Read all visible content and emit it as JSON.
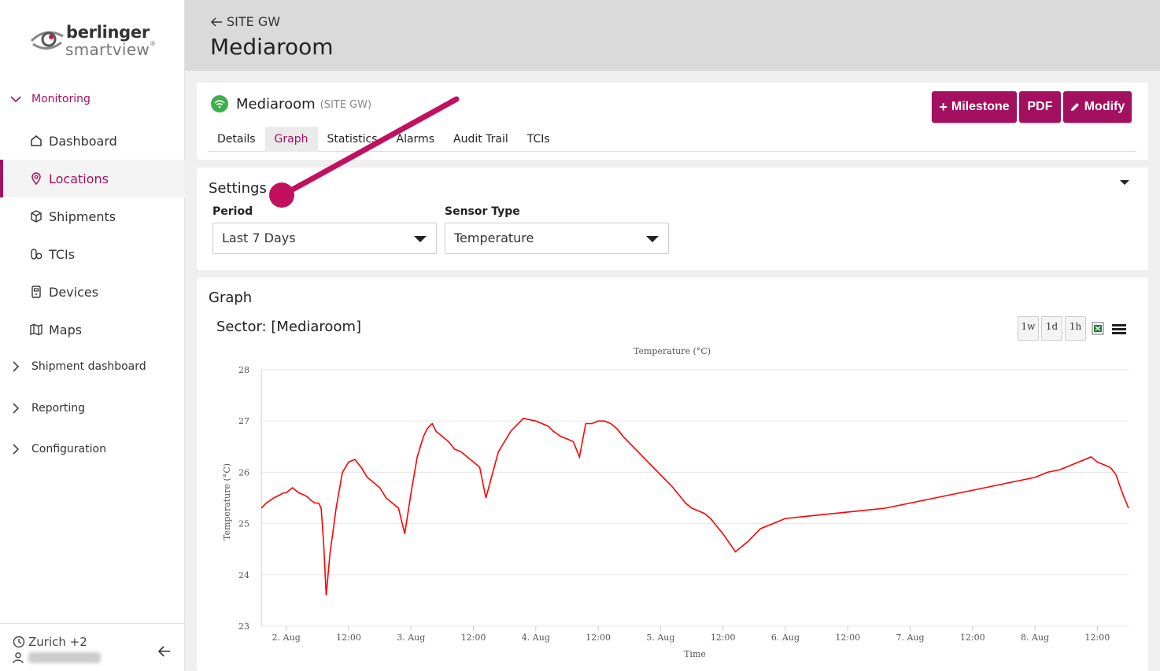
{
  "brand": {
    "line1": "berlinger",
    "line2": "smartview",
    "reg": "®"
  },
  "sidebar": {
    "groups": [
      {
        "label": "Monitoring",
        "open": true
      },
      {
        "label": "Shipment dashboard"
      },
      {
        "label": "Reporting"
      },
      {
        "label": "Configuration"
      }
    ],
    "items": [
      {
        "label": "Dashboard",
        "icon": "home-icon"
      },
      {
        "label": "Locations",
        "icon": "location-pin-icon",
        "active": true
      },
      {
        "label": "Shipments",
        "icon": "box-icon"
      },
      {
        "label": "TCIs",
        "icon": "pills-icon"
      },
      {
        "label": "Devices",
        "icon": "device-icon"
      },
      {
        "label": "Maps",
        "icon": "map-icon"
      }
    ],
    "footer": {
      "zone": "Zurich +2"
    }
  },
  "header": {
    "back_label": "SITE GW",
    "title": "Mediaroom"
  },
  "location": {
    "name": "Mediaroom",
    "site": "(SITE GW)",
    "status_color": "#3cae4a",
    "buttons": {
      "milestone": "Milestone",
      "pdf": "PDF",
      "modify": "Modify"
    },
    "tabs": [
      "Details",
      "Graph",
      "Statistics",
      "Alarms",
      "Audit Trail",
      "TCIs"
    ],
    "active_tab": "Graph"
  },
  "settings": {
    "title": "Settings",
    "period_label": "Period",
    "period_value": "Last 7 Days",
    "sensor_label": "Sensor Type",
    "sensor_value": "Temperature"
  },
  "graph": {
    "title": "Graph",
    "sector": "Sector: [Mediaroom]",
    "zoom_buttons": [
      "1w",
      "1d",
      "1h"
    ]
  },
  "colors": {
    "accent": "#a3105f",
    "line": "#ff0000"
  },
  "chart_data": {
    "type": "line",
    "title": "Temperature (°C)",
    "xlabel": "Time",
    "ylabel": "Temperature (°C)",
    "ylim": [
      23,
      28
    ],
    "yticks": [
      23,
      24,
      25,
      26,
      27,
      28
    ],
    "xlim": [
      0.8,
      7.75
    ],
    "xticks": [
      {
        "x": 1,
        "label": "2. Aug"
      },
      {
        "x": 1.5,
        "label": "12:00"
      },
      {
        "x": 2,
        "label": "3. Aug"
      },
      {
        "x": 2.5,
        "label": "12:00"
      },
      {
        "x": 3,
        "label": "4. Aug"
      },
      {
        "x": 3.5,
        "label": "12:00"
      },
      {
        "x": 4,
        "label": "5. Aug"
      },
      {
        "x": 4.5,
        "label": "12:00"
      },
      {
        "x": 5,
        "label": "6. Aug"
      },
      {
        "x": 5.5,
        "label": "12:00"
      },
      {
        "x": 6,
        "label": "7. Aug"
      },
      {
        "x": 6.5,
        "label": "12:00"
      },
      {
        "x": 7,
        "label": "8. Aug"
      },
      {
        "x": 7.5,
        "label": "12:00"
      }
    ],
    "grid": true,
    "series": [
      {
        "color": "#ff0000",
        "x": [
          0.8,
          0.84,
          0.9,
          0.98,
          1.0,
          1.05,
          1.1,
          1.15,
          1.18,
          1.2,
          1.23,
          1.26,
          1.28,
          1.3,
          1.32,
          1.35,
          1.4,
          1.45,
          1.5,
          1.55,
          1.6,
          1.65,
          1.7,
          1.75,
          1.8,
          1.85,
          1.9,
          1.95,
          2.0,
          2.05,
          2.1,
          2.13,
          2.15,
          2.17,
          2.2,
          2.25,
          2.3,
          2.35,
          2.4,
          2.45,
          2.5,
          2.55,
          2.6,
          2.7,
          2.8,
          2.9,
          3.0,
          3.05,
          3.1,
          3.12,
          3.14,
          3.17,
          3.2,
          3.25,
          3.3,
          3.35,
          3.4,
          3.45,
          3.5,
          3.55,
          3.6,
          3.65,
          3.7,
          3.8,
          3.9,
          4.0,
          4.1,
          4.15,
          4.2,
          4.25,
          4.3,
          4.35,
          4.4,
          4.45,
          4.5,
          4.6,
          4.7,
          4.8,
          4.9,
          5.0,
          5.2,
          5.4,
          5.6,
          5.8,
          6.0,
          6.2,
          6.4,
          6.6,
          6.8,
          7.0,
          7.1,
          7.2,
          7.25,
          7.3,
          7.35,
          7.4,
          7.45,
          7.5,
          7.55,
          7.6,
          7.62,
          7.65,
          7.7,
          7.75
        ],
        "values": [
          25.3,
          25.4,
          25.5,
          25.6,
          25.6,
          25.7,
          25.6,
          25.55,
          25.5,
          25.45,
          25.4,
          25.4,
          25.3,
          24.6,
          23.6,
          24.4,
          25.3,
          26.0,
          26.2,
          26.25,
          26.1,
          25.9,
          25.8,
          25.7,
          25.5,
          25.4,
          25.3,
          24.8,
          25.6,
          26.3,
          26.7,
          26.85,
          26.9,
          26.95,
          26.8,
          26.7,
          26.6,
          26.45,
          26.4,
          26.3,
          26.2,
          26.1,
          25.5,
          26.4,
          26.8,
          27.05,
          27.0,
          26.95,
          26.9,
          26.85,
          26.8,
          26.75,
          26.7,
          26.65,
          26.6,
          26.3,
          26.95,
          26.95,
          27.0,
          27.0,
          26.95,
          26.85,
          26.7,
          26.45,
          26.2,
          25.95,
          25.7,
          25.55,
          25.4,
          25.3,
          25.25,
          25.2,
          25.1,
          24.95,
          24.8,
          24.45,
          24.65,
          24.9,
          25.0,
          25.1,
          25.15,
          25.2,
          25.25,
          25.3,
          25.4,
          25.5,
          25.6,
          25.7,
          25.8,
          25.9,
          26.0,
          26.05,
          26.1,
          26.15,
          26.2,
          26.25,
          26.3,
          26.2,
          26.15,
          26.1,
          26.05,
          25.95,
          25.6,
          25.3
        ]
      }
    ]
  }
}
